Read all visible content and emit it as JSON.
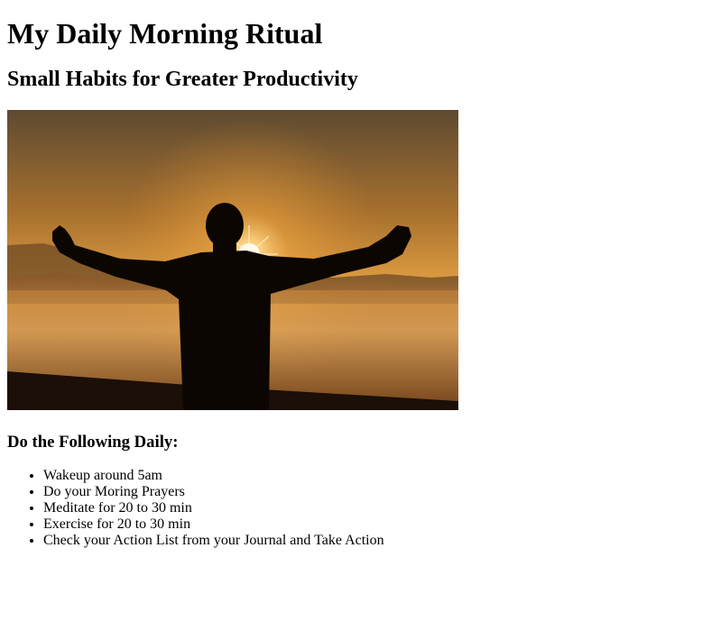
{
  "page": {
    "title": "My Daily Morning Ritual",
    "subtitle": "Small Habits for Greater Productivity",
    "list_heading": "Do the Following Daily:",
    "ritual_items": [
      "Wakeup around 5am",
      "Do your Moring Prayers",
      "Meditate for 20 to 30 min",
      "Exercise for 20 to 30 min",
      "Check your Action List from your Journal and Take Action"
    ]
  },
  "colors": {
    "sky_top": "#6b5537",
    "sky_mid": "#c98734",
    "sun": "#fff6d8",
    "silhouette": "#0c0603",
    "text": "#000000"
  }
}
